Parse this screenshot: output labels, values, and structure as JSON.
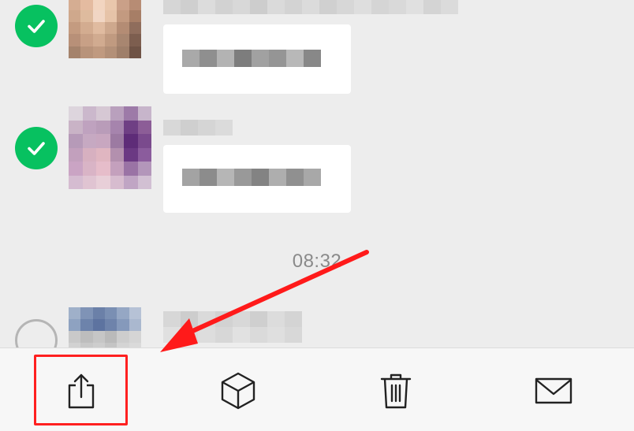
{
  "chat": {
    "timestamp": "08:32",
    "messages": [
      {
        "selected": true
      },
      {
        "selected": true
      },
      {
        "selected": false
      }
    ]
  },
  "toolbar": {
    "buttons": [
      {
        "icon": "share-icon"
      },
      {
        "icon": "box-icon"
      },
      {
        "icon": "trash-icon"
      },
      {
        "icon": "mail-icon"
      }
    ]
  },
  "colors": {
    "check_green": "#07c160",
    "highlight_red": "#ff2020",
    "background": "#ededed",
    "toolbar_bg": "#f7f7f7"
  }
}
